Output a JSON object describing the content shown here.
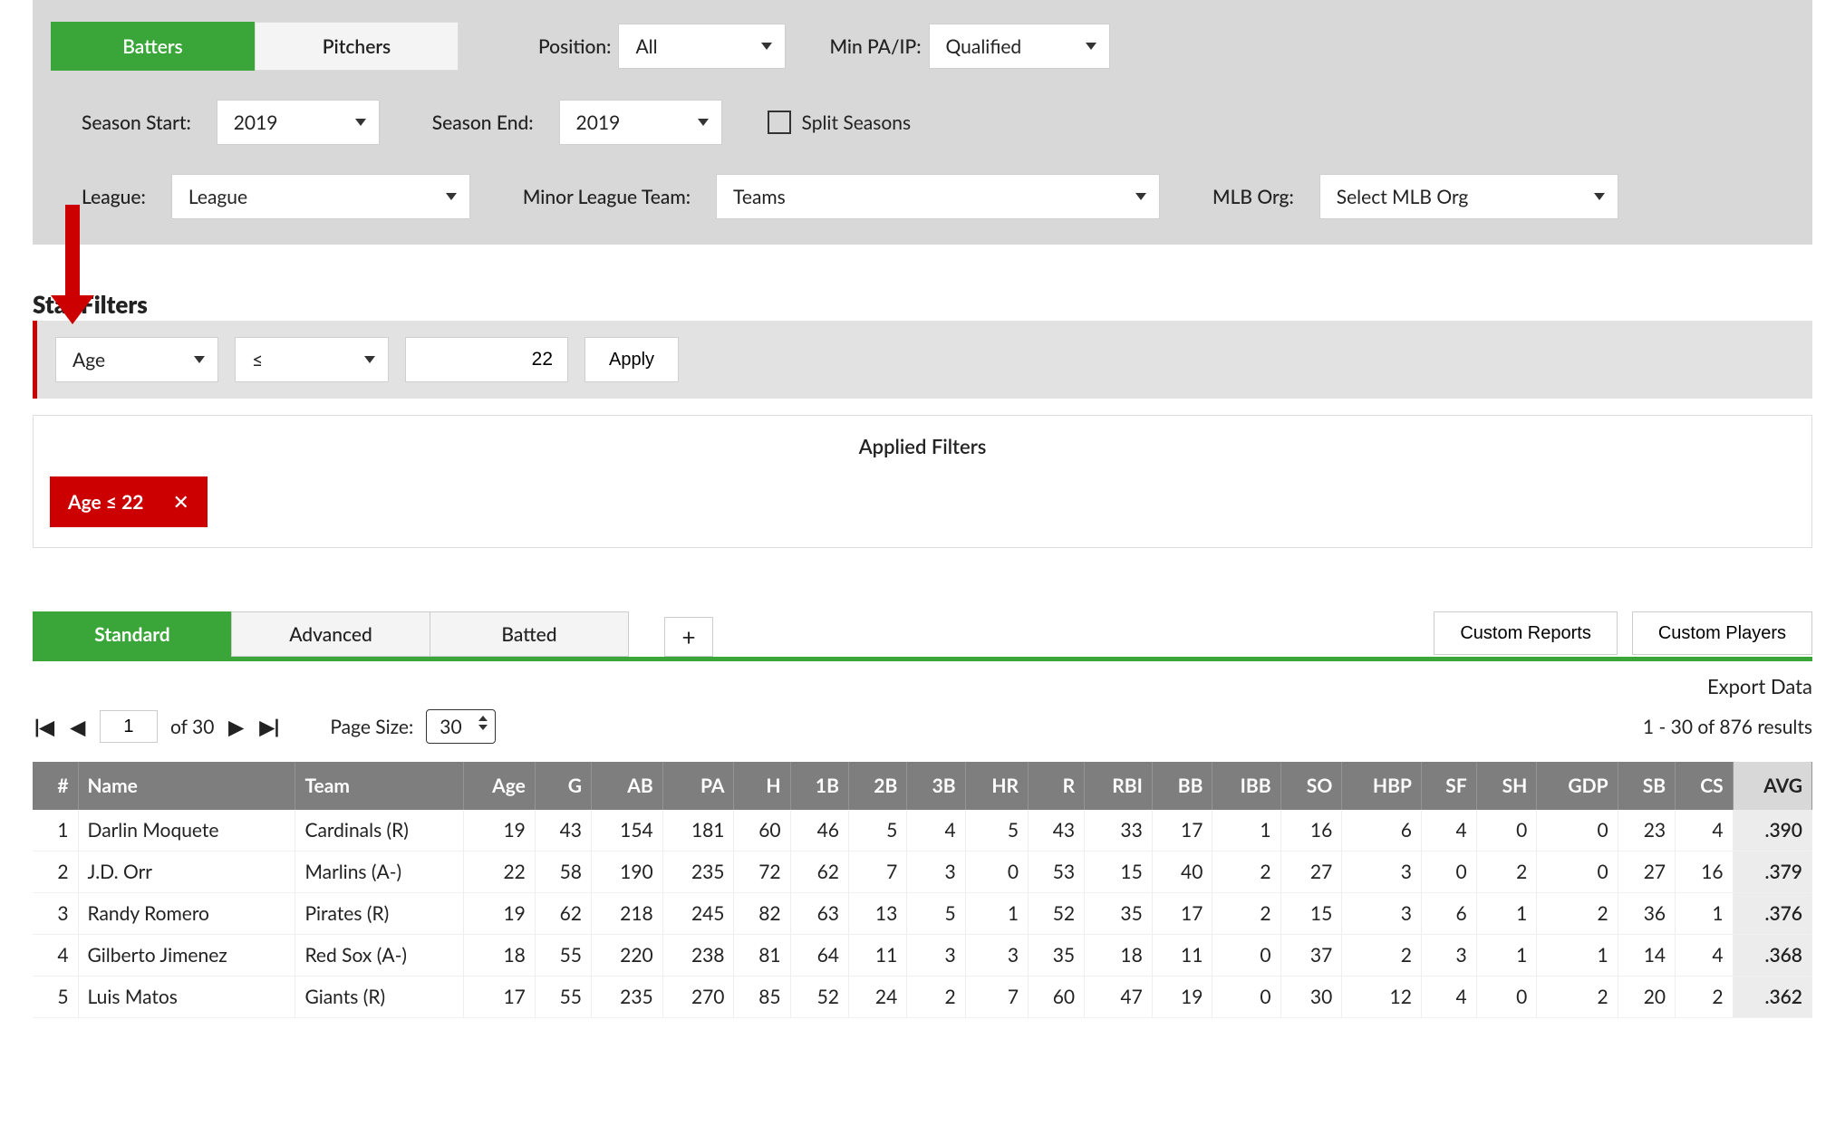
{
  "tabs": {
    "batters": "Batters",
    "pitchers": "Pitchers"
  },
  "position": {
    "label": "Position:",
    "value": "All"
  },
  "minpaip": {
    "label": "Min PA/IP:",
    "value": "Qualified"
  },
  "season_start": {
    "label": "Season Start:",
    "value": "2019"
  },
  "season_end": {
    "label": "Season End:",
    "value": "2019"
  },
  "split": {
    "label": "Split Seasons"
  },
  "league": {
    "label": "League:",
    "value": "League"
  },
  "minor": {
    "label": "Minor League Team:",
    "value": "Teams"
  },
  "mlborg": {
    "label": "MLB Org:",
    "value": "Select MLB Org"
  },
  "stat_filters_title": "Stat Filters",
  "sf_field": "Age",
  "sf_op": "≤",
  "sf_value": "22",
  "sf_apply": "Apply",
  "applied_title": "Applied Filters",
  "chip_text": "Age ≤ 22",
  "chip_close": "✕",
  "rpt_tabs": {
    "standard": "Standard",
    "advanced": "Advanced",
    "batted": "Batted"
  },
  "plus": "+",
  "custom_reports": "Custom Reports",
  "custom_players": "Custom Players",
  "export": "Export Data",
  "pager": {
    "first": "❘◀",
    "prev": "◀",
    "page": "1",
    "of": "of 30",
    "next": "▶",
    "last": "▶❘"
  },
  "page_size_label": "Page Size:",
  "page_size_value": "30",
  "results_count": "1 - 30 of 876 results",
  "cols": [
    "#",
    "Name",
    "Team",
    "Age",
    "G",
    "AB",
    "PA",
    "H",
    "1B",
    "2B",
    "3B",
    "HR",
    "R",
    "RBI",
    "BB",
    "IBB",
    "SO",
    "HBP",
    "SF",
    "SH",
    "GDP",
    "SB",
    "CS",
    "AVG"
  ],
  "rows": [
    {
      "n": "1",
      "name": "Darlin Moquete",
      "team": "Cardinals (R)",
      "c": [
        "19",
        "43",
        "154",
        "181",
        "60",
        "46",
        "5",
        "4",
        "5",
        "43",
        "33",
        "17",
        "1",
        "16",
        "6",
        "4",
        "0",
        "0",
        "23",
        "4",
        ".390"
      ]
    },
    {
      "n": "2",
      "name": "J.D. Orr",
      "team": "Marlins (A-)",
      "c": [
        "22",
        "58",
        "190",
        "235",
        "72",
        "62",
        "7",
        "3",
        "0",
        "53",
        "15",
        "40",
        "2",
        "27",
        "3",
        "0",
        "2",
        "0",
        "27",
        "16",
        ".379"
      ]
    },
    {
      "n": "3",
      "name": "Randy Romero",
      "team": "Pirates (R)",
      "c": [
        "19",
        "62",
        "218",
        "245",
        "82",
        "63",
        "13",
        "5",
        "1",
        "52",
        "35",
        "17",
        "2",
        "15",
        "3",
        "6",
        "1",
        "2",
        "36",
        "1",
        ".376"
      ]
    },
    {
      "n": "4",
      "name": "Gilberto Jimenez",
      "team": "Red Sox (A-)",
      "c": [
        "18",
        "55",
        "220",
        "238",
        "81",
        "64",
        "11",
        "3",
        "3",
        "35",
        "18",
        "11",
        "0",
        "37",
        "2",
        "3",
        "1",
        "1",
        "14",
        "4",
        ".368"
      ]
    },
    {
      "n": "5",
      "name": "Luis Matos",
      "team": "Giants (R)",
      "c": [
        "17",
        "55",
        "235",
        "270",
        "85",
        "52",
        "24",
        "2",
        "7",
        "60",
        "47",
        "19",
        "0",
        "30",
        "12",
        "4",
        "0",
        "2",
        "20",
        "2",
        ".362"
      ]
    }
  ]
}
